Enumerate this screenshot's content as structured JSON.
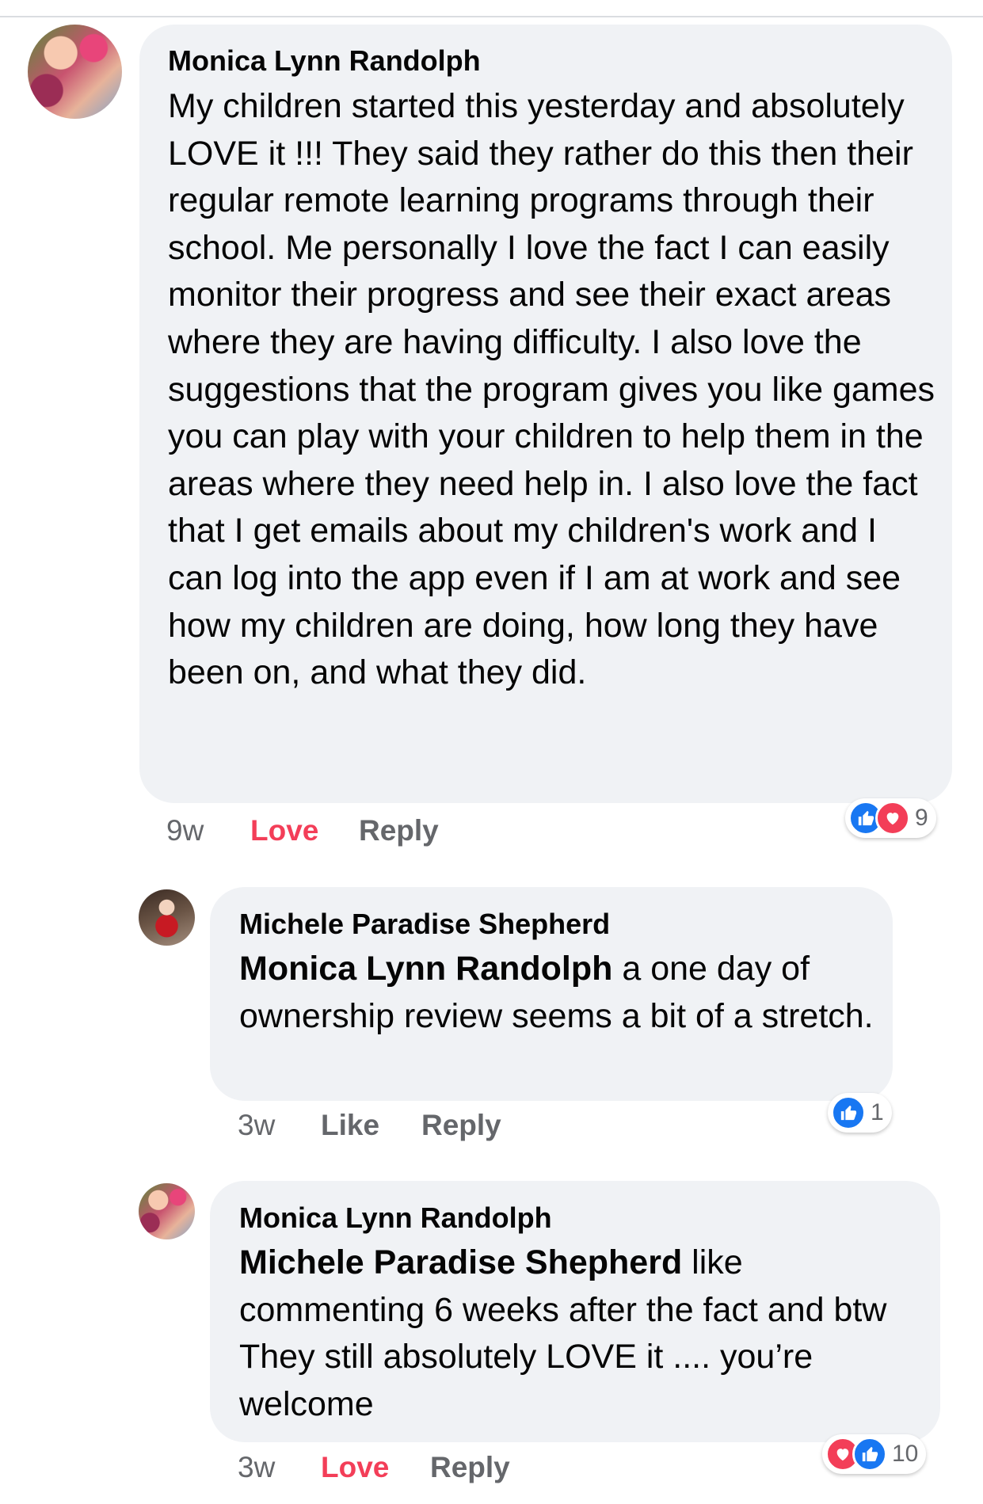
{
  "comments": [
    {
      "author": "Monica Lynn Randolph",
      "text": "My children started this yesterday and absolutely LOVE  it !!! They said they rather do this then their regular remote learning programs through their school. Me personally I love the fact I can easily monitor their progress and see their exact areas where they are having difficulty. I also love the suggestions that the program gives you like games you can play with your children to help them in the areas where they need help in. I also love the fact that I get emails about my children's work and I can log into the app even if I am at work and see how my children are doing, how long they have been on, and what they did.",
      "time": "9w",
      "reaction_label": "Love",
      "reply_label": "Reply",
      "reactions": [
        "like-icon",
        "heart-icon"
      ],
      "reaction_count": "9"
    },
    {
      "author": "Michele Paradise Shepherd",
      "mention": "Monica Lynn Randolph",
      "text": " a one day of ownership review seems a bit of a stretch.",
      "time": "3w",
      "reaction_label": "Like",
      "reply_label": "Reply",
      "reactions": [
        "like-icon"
      ],
      "reaction_count": "1"
    },
    {
      "author": "Monica Lynn Randolph",
      "mention": "Michele Paradise Shepherd",
      "text": " like commenting 6 weeks after the fact and btw They still absolutely LOVE it .... you’re welcome",
      "time": "3w",
      "reaction_label": "Love",
      "reply_label": "Reply",
      "reactions": [
        "heart-icon",
        "like-icon"
      ],
      "reaction_count": "10"
    }
  ],
  "colors": {
    "bubble": "#f0f2f5",
    "love": "#f33e58",
    "like": "#1877f2",
    "meta": "#65676b"
  }
}
